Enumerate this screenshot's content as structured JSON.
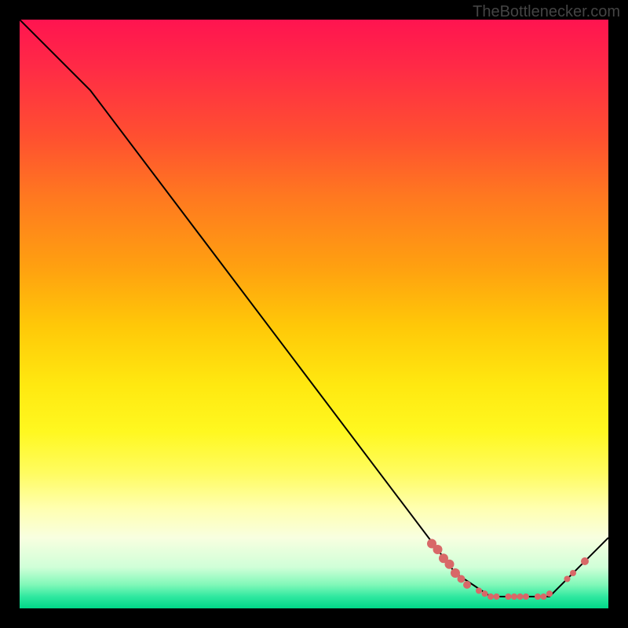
{
  "watermark": "TheBottlenecker.com",
  "chart_data": {
    "type": "line",
    "title": "",
    "xlabel": "",
    "ylabel": "",
    "xlim": [
      0,
      100
    ],
    "ylim": [
      0,
      100
    ],
    "grid": false,
    "line": {
      "color": "#000000",
      "points": [
        {
          "x": 0,
          "y": 100
        },
        {
          "x": 12,
          "y": 88
        },
        {
          "x": 74,
          "y": 6
        },
        {
          "x": 80,
          "y": 2
        },
        {
          "x": 90,
          "y": 2
        },
        {
          "x": 100,
          "y": 12
        }
      ]
    },
    "scatter": {
      "color": "#d86868",
      "radius_small": 4,
      "radius_large": 6,
      "points": [
        {
          "x": 70,
          "y": 11,
          "r": 6
        },
        {
          "x": 71,
          "y": 10,
          "r": 6
        },
        {
          "x": 72,
          "y": 8.5,
          "r": 6
        },
        {
          "x": 73,
          "y": 7.5,
          "r": 6
        },
        {
          "x": 74,
          "y": 6,
          "r": 6
        },
        {
          "x": 75,
          "y": 5,
          "r": 5
        },
        {
          "x": 76,
          "y": 4,
          "r": 5
        },
        {
          "x": 78,
          "y": 3,
          "r": 4
        },
        {
          "x": 79,
          "y": 2.5,
          "r": 4
        },
        {
          "x": 80,
          "y": 2,
          "r": 4
        },
        {
          "x": 81,
          "y": 2,
          "r": 4
        },
        {
          "x": 83,
          "y": 2,
          "r": 4
        },
        {
          "x": 84,
          "y": 2,
          "r": 4
        },
        {
          "x": 85,
          "y": 2,
          "r": 4
        },
        {
          "x": 86,
          "y": 2,
          "r": 4
        },
        {
          "x": 88,
          "y": 2,
          "r": 4
        },
        {
          "x": 89,
          "y": 2,
          "r": 4
        },
        {
          "x": 90,
          "y": 2.5,
          "r": 4
        },
        {
          "x": 93,
          "y": 5,
          "r": 4
        },
        {
          "x": 94,
          "y": 6,
          "r": 4
        },
        {
          "x": 96,
          "y": 8,
          "r": 5
        }
      ]
    },
    "background_gradient": {
      "stops": [
        {
          "pos": 0,
          "color": "#ff1450"
        },
        {
          "pos": 50,
          "color": "#ffc808"
        },
        {
          "pos": 75,
          "color": "#fffc60"
        },
        {
          "pos": 100,
          "color": "#00d888"
        }
      ]
    }
  }
}
